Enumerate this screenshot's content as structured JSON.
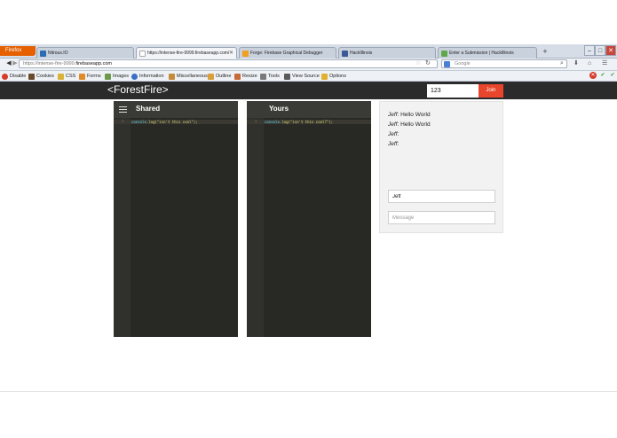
{
  "browser": {
    "menu_button": "Firefox",
    "tabs": [
      {
        "label": "Nitrous.IO",
        "active": false
      },
      {
        "label": "https://intense-fire-9999.firebaseapp.com/",
        "active": true
      },
      {
        "label": "Forge: Firebase Graphical Debugger",
        "active": false
      },
      {
        "label": "HackIllinois",
        "active": false
      },
      {
        "label": "Enter a Submission | HackIllinois",
        "active": false
      }
    ],
    "new_tab": "+",
    "url_prefix": "https://intense-fire-9999.",
    "url_host": "firebaseapp.com",
    "search_placeholder": "Google",
    "toolbar": [
      "Disable",
      "Cookies",
      "CSS",
      "Forms",
      "Images",
      "Information",
      "Miscellaneous",
      "Outline",
      "Resize",
      "Tools",
      "View Source",
      "Options"
    ]
  },
  "app": {
    "title": "<ForestFire>",
    "room_input_value": "123",
    "join_label": "Join"
  },
  "editors": [
    {
      "title": "Shared",
      "line_number": "1",
      "code_keyword": "console",
      "code_rest": ".log(\"isn't this cool\");"
    },
    {
      "title": "Yours",
      "line_number": "1",
      "code_keyword": "console",
      "code_rest": ".log(\"isn't this cool?\");"
    }
  ],
  "chat": {
    "messages": [
      {
        "user": "Jeff",
        "text": ": Hello World"
      },
      {
        "user": "Jeff",
        "text": ": Hello World"
      },
      {
        "user": "Jeff",
        "text": ":"
      },
      {
        "user": "Jeff",
        "text": ":"
      }
    ],
    "name_value": "Jeff",
    "message_placeholder": "Message"
  },
  "colors": {
    "appbar": "#2b2b2b",
    "join": "#e8462c",
    "editor_bg": "#282824",
    "chat_bg": "#f2f2f2"
  }
}
